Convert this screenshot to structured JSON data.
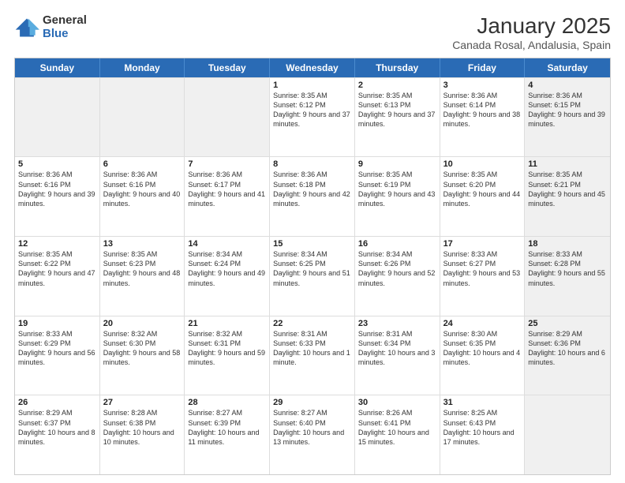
{
  "logo": {
    "general": "General",
    "blue": "Blue"
  },
  "header": {
    "title": "January 2025",
    "subtitle": "Canada Rosal, Andalusia, Spain"
  },
  "dayHeaders": [
    "Sunday",
    "Monday",
    "Tuesday",
    "Wednesday",
    "Thursday",
    "Friday",
    "Saturday"
  ],
  "weeks": [
    [
      {
        "day": "",
        "text": "",
        "shaded": true
      },
      {
        "day": "",
        "text": "",
        "shaded": true
      },
      {
        "day": "",
        "text": "",
        "shaded": true
      },
      {
        "day": "1",
        "text": "Sunrise: 8:35 AM\nSunset: 6:12 PM\nDaylight: 9 hours\nand 37 minutes.",
        "shaded": false
      },
      {
        "day": "2",
        "text": "Sunrise: 8:35 AM\nSunset: 6:13 PM\nDaylight: 9 hours\nand 37 minutes.",
        "shaded": false
      },
      {
        "day": "3",
        "text": "Sunrise: 8:36 AM\nSunset: 6:14 PM\nDaylight: 9 hours\nand 38 minutes.",
        "shaded": false
      },
      {
        "day": "4",
        "text": "Sunrise: 8:36 AM\nSunset: 6:15 PM\nDaylight: 9 hours\nand 39 minutes.",
        "shaded": true
      }
    ],
    [
      {
        "day": "5",
        "text": "Sunrise: 8:36 AM\nSunset: 6:16 PM\nDaylight: 9 hours\nand 39 minutes.",
        "shaded": false
      },
      {
        "day": "6",
        "text": "Sunrise: 8:36 AM\nSunset: 6:16 PM\nDaylight: 9 hours\nand 40 minutes.",
        "shaded": false
      },
      {
        "day": "7",
        "text": "Sunrise: 8:36 AM\nSunset: 6:17 PM\nDaylight: 9 hours\nand 41 minutes.",
        "shaded": false
      },
      {
        "day": "8",
        "text": "Sunrise: 8:36 AM\nSunset: 6:18 PM\nDaylight: 9 hours\nand 42 minutes.",
        "shaded": false
      },
      {
        "day": "9",
        "text": "Sunrise: 8:35 AM\nSunset: 6:19 PM\nDaylight: 9 hours\nand 43 minutes.",
        "shaded": false
      },
      {
        "day": "10",
        "text": "Sunrise: 8:35 AM\nSunset: 6:20 PM\nDaylight: 9 hours\nand 44 minutes.",
        "shaded": false
      },
      {
        "day": "11",
        "text": "Sunrise: 8:35 AM\nSunset: 6:21 PM\nDaylight: 9 hours\nand 45 minutes.",
        "shaded": true
      }
    ],
    [
      {
        "day": "12",
        "text": "Sunrise: 8:35 AM\nSunset: 6:22 PM\nDaylight: 9 hours\nand 47 minutes.",
        "shaded": false
      },
      {
        "day": "13",
        "text": "Sunrise: 8:35 AM\nSunset: 6:23 PM\nDaylight: 9 hours\nand 48 minutes.",
        "shaded": false
      },
      {
        "day": "14",
        "text": "Sunrise: 8:34 AM\nSunset: 6:24 PM\nDaylight: 9 hours\nand 49 minutes.",
        "shaded": false
      },
      {
        "day": "15",
        "text": "Sunrise: 8:34 AM\nSunset: 6:25 PM\nDaylight: 9 hours\nand 51 minutes.",
        "shaded": false
      },
      {
        "day": "16",
        "text": "Sunrise: 8:34 AM\nSunset: 6:26 PM\nDaylight: 9 hours\nand 52 minutes.",
        "shaded": false
      },
      {
        "day": "17",
        "text": "Sunrise: 8:33 AM\nSunset: 6:27 PM\nDaylight: 9 hours\nand 53 minutes.",
        "shaded": false
      },
      {
        "day": "18",
        "text": "Sunrise: 8:33 AM\nSunset: 6:28 PM\nDaylight: 9 hours\nand 55 minutes.",
        "shaded": true
      }
    ],
    [
      {
        "day": "19",
        "text": "Sunrise: 8:33 AM\nSunset: 6:29 PM\nDaylight: 9 hours\nand 56 minutes.",
        "shaded": false
      },
      {
        "day": "20",
        "text": "Sunrise: 8:32 AM\nSunset: 6:30 PM\nDaylight: 9 hours\nand 58 minutes.",
        "shaded": false
      },
      {
        "day": "21",
        "text": "Sunrise: 8:32 AM\nSunset: 6:31 PM\nDaylight: 9 hours\nand 59 minutes.",
        "shaded": false
      },
      {
        "day": "22",
        "text": "Sunrise: 8:31 AM\nSunset: 6:33 PM\nDaylight: 10 hours\nand 1 minute.",
        "shaded": false
      },
      {
        "day": "23",
        "text": "Sunrise: 8:31 AM\nSunset: 6:34 PM\nDaylight: 10 hours\nand 3 minutes.",
        "shaded": false
      },
      {
        "day": "24",
        "text": "Sunrise: 8:30 AM\nSunset: 6:35 PM\nDaylight: 10 hours\nand 4 minutes.",
        "shaded": false
      },
      {
        "day": "25",
        "text": "Sunrise: 8:29 AM\nSunset: 6:36 PM\nDaylight: 10 hours\nand 6 minutes.",
        "shaded": true
      }
    ],
    [
      {
        "day": "26",
        "text": "Sunrise: 8:29 AM\nSunset: 6:37 PM\nDaylight: 10 hours\nand 8 minutes.",
        "shaded": false
      },
      {
        "day": "27",
        "text": "Sunrise: 8:28 AM\nSunset: 6:38 PM\nDaylight: 10 hours\nand 10 minutes.",
        "shaded": false
      },
      {
        "day": "28",
        "text": "Sunrise: 8:27 AM\nSunset: 6:39 PM\nDaylight: 10 hours\nand 11 minutes.",
        "shaded": false
      },
      {
        "day": "29",
        "text": "Sunrise: 8:27 AM\nSunset: 6:40 PM\nDaylight: 10 hours\nand 13 minutes.",
        "shaded": false
      },
      {
        "day": "30",
        "text": "Sunrise: 8:26 AM\nSunset: 6:41 PM\nDaylight: 10 hours\nand 15 minutes.",
        "shaded": false
      },
      {
        "day": "31",
        "text": "Sunrise: 8:25 AM\nSunset: 6:43 PM\nDaylight: 10 hours\nand 17 minutes.",
        "shaded": false
      },
      {
        "day": "",
        "text": "",
        "shaded": true
      }
    ]
  ]
}
